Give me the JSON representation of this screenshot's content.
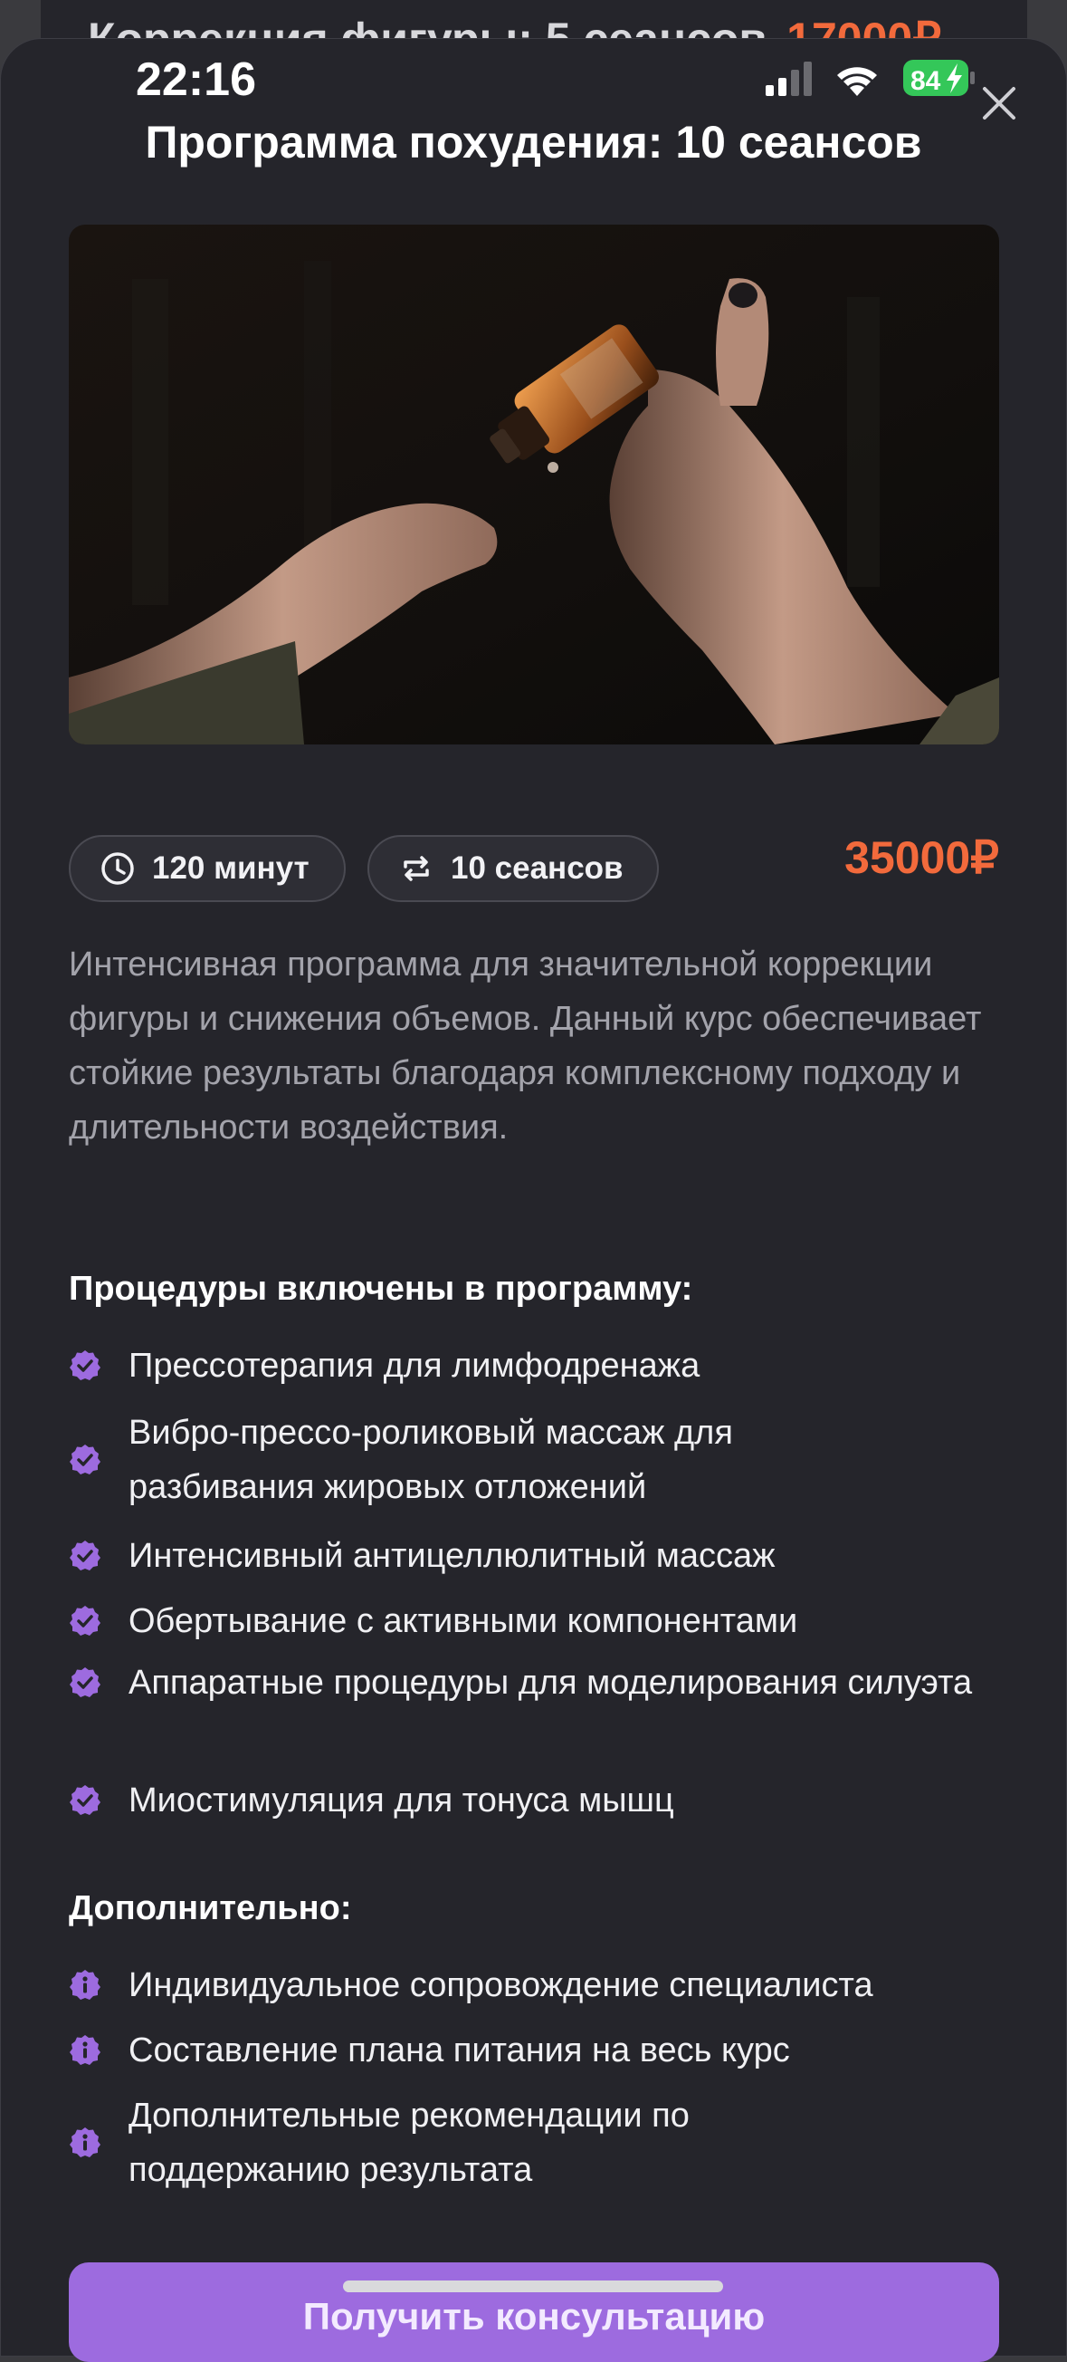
{
  "background_card": {
    "title": "Коррекция фигуры: 5 сеансов",
    "price": "17000₽"
  },
  "status_bar": {
    "time": "22:16",
    "battery": "84"
  },
  "modal": {
    "title": "Программа похудения: 10 сеансов",
    "image_icon": "hand-dropper-oil-photo",
    "duration": "120 минут",
    "sessions": "10 сеансов",
    "price": "35000₽",
    "description": "Интенсивная программа для значительной коррекции фигуры и снижения объемов. Данный курс обеспечивает стойкие результаты благодаря комплексному подходу и длительности воздействия.",
    "procedures_title": "Процедуры включены в программу:",
    "procedures": [
      "Прессотерапия для лимфодренажа",
      "Вибро-прессо-роликовый массаж для разбивания жировых отложений",
      "Интенсивный антицеллюлитный массаж",
      "Обертывание с активными компонентами",
      "Аппаратные процедуры для моделирования силуэта",
      "Миостимуляция для тонуса мышц"
    ],
    "extras_title": "Дополнительно:",
    "extras": [
      "Индивидуальное сопровождение специалиста",
      "Составление плана питания на весь курс",
      "Дополнительные рекомендации по поддержанию результата"
    ],
    "cta_label": "Получить консультацию"
  },
  "colors": {
    "accent": "#9d6bdf",
    "price": "#f26a3c",
    "sheet_bg": "#25252b"
  }
}
